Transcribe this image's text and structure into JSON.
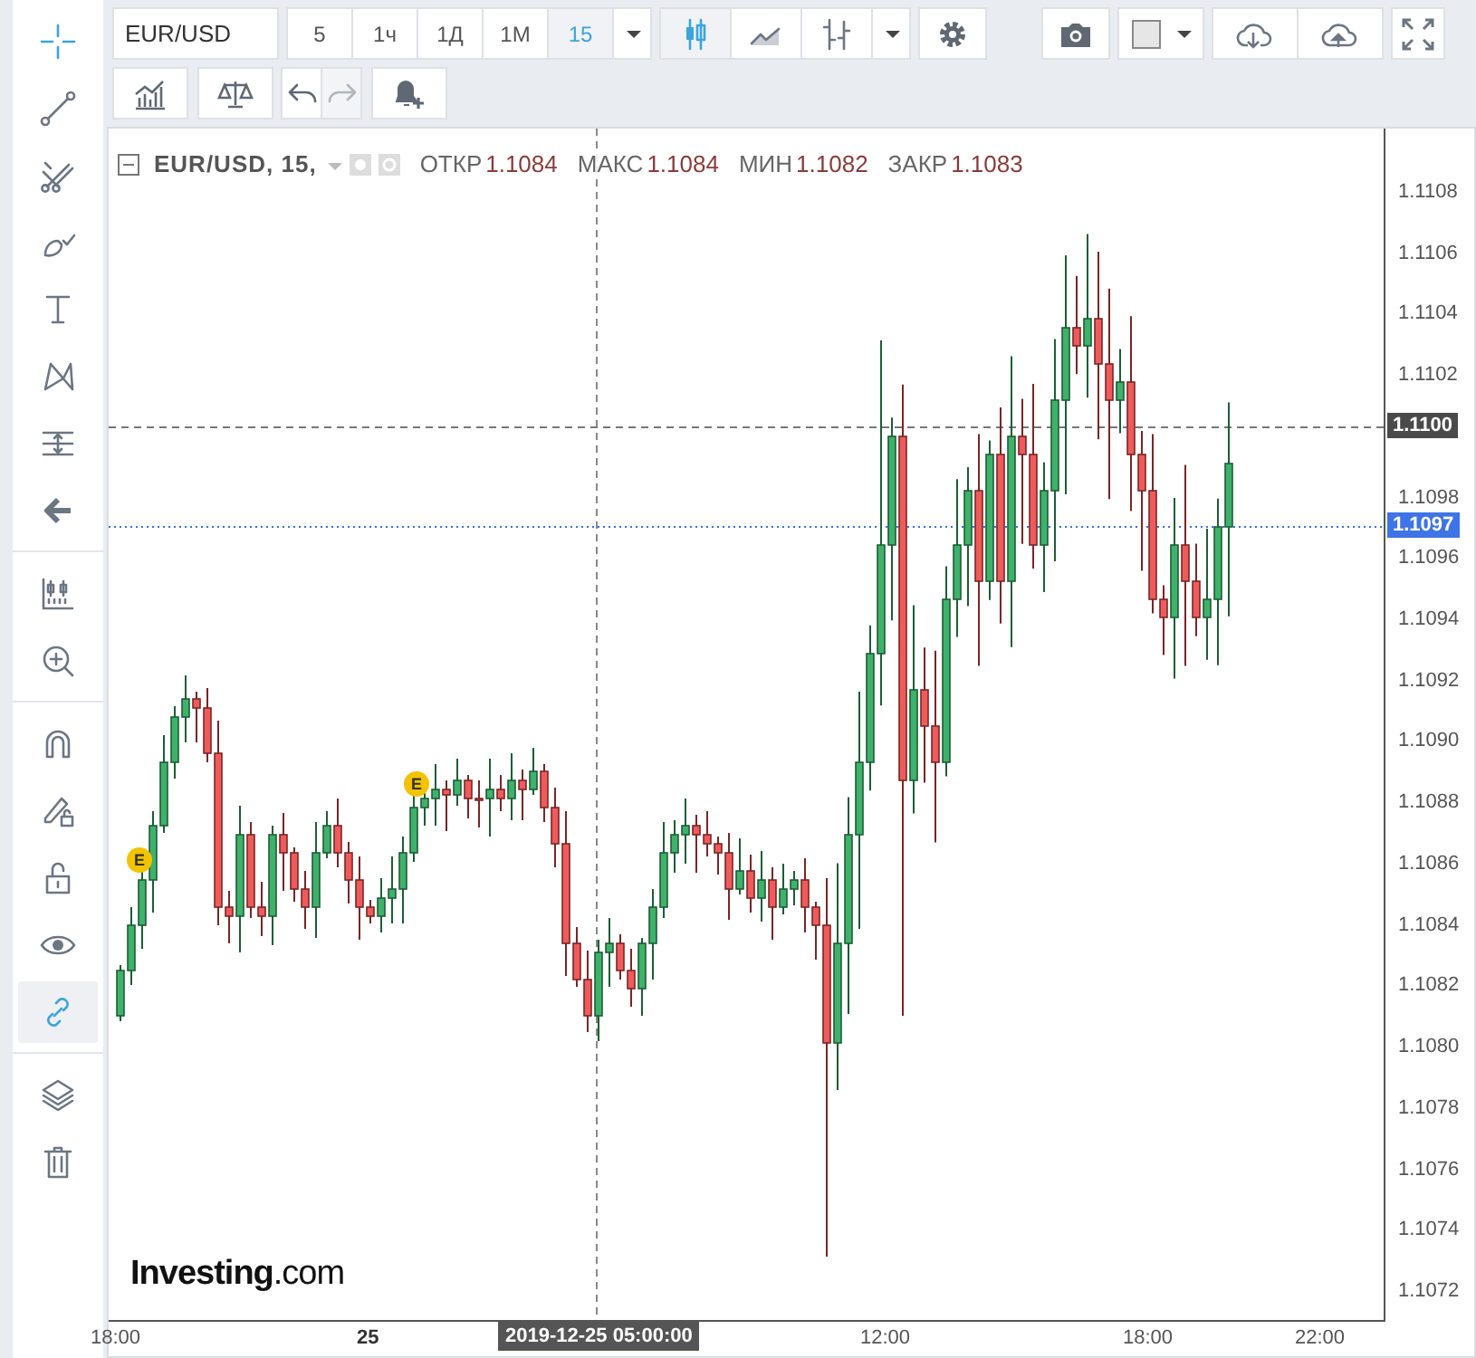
{
  "sidebar": {
    "groups": [
      [
        {
          "kind": "crosshair",
          "selected": true
        },
        {
          "kind": "trend-line",
          "selected": false
        },
        {
          "kind": "fork",
          "selected": false
        },
        {
          "kind": "brush",
          "selected": false
        },
        {
          "kind": "text",
          "selected": false
        },
        {
          "kind": "pattern",
          "selected": false
        },
        {
          "kind": "measure",
          "selected": false
        },
        {
          "kind": "arrow",
          "selected": false
        }
      ],
      [
        {
          "kind": "candle-ruler",
          "selected": false
        },
        {
          "kind": "zoom",
          "selected": false
        }
      ],
      [
        {
          "kind": "magnet",
          "selected": false
        },
        {
          "kind": "pencil-lock",
          "selected": false
        },
        {
          "kind": "lock",
          "selected": false
        },
        {
          "kind": "eye",
          "selected": false
        },
        {
          "kind": "link",
          "selected": true
        }
      ],
      [
        {
          "kind": "layers",
          "selected": false
        },
        {
          "kind": "trash",
          "selected": false
        }
      ]
    ]
  },
  "toolbar": {
    "symbol": "EUR/USD",
    "intervals": [
      {
        "label": "5",
        "selected": false
      },
      {
        "label": "1ч",
        "selected": false
      },
      {
        "label": "1Д",
        "selected": false
      },
      {
        "label": "1М",
        "selected": false
      },
      {
        "label": "15",
        "selected": true
      }
    ],
    "chart_types": [
      {
        "kind": "candles",
        "selected": true
      },
      {
        "kind": "area",
        "selected": false
      },
      {
        "kind": "bars",
        "selected": false
      }
    ],
    "history": [
      {
        "kind": "undo",
        "disabled": false
      },
      {
        "kind": "redo",
        "disabled": true
      }
    ]
  },
  "legend": {
    "symbol": "EUR/USD, 15,",
    "fields": [
      {
        "label": "ОТКР",
        "value": "1.1084"
      },
      {
        "label": "МАКС",
        "value": "1.1084"
      },
      {
        "label": "МИН",
        "value": "1.1082"
      },
      {
        "label": "ЗАКР",
        "value": "1.1083"
      }
    ]
  },
  "price_axis": {
    "labels": [
      "1.1108",
      "1.1106",
      "1.1104",
      "1.1102",
      "1.1098",
      "1.1096",
      "1.1094",
      "1.1092",
      "1.1090",
      "1.1088",
      "1.1086",
      "1.1084",
      "1.1082",
      "1.1080",
      "1.1078",
      "1.1076",
      "1.1074",
      "1.1072"
    ],
    "badges": [
      {
        "kind": "line",
        "value": "1.1100"
      },
      {
        "kind": "bid",
        "value": "1.1097"
      }
    ]
  },
  "time_axis": {
    "labels": [
      {
        "label": "18:00",
        "bold": false
      },
      {
        "label": "25",
        "bold": true
      },
      {
        "label": "12:00",
        "bold": false
      },
      {
        "label": "18:00",
        "bold": false
      },
      {
        "label": "22:00",
        "bold": false
      }
    ],
    "crosshair": "2019-12-25 05:00:00"
  },
  "events": [
    {
      "label": "E"
    },
    {
      "label": "E"
    }
  ],
  "logo": "**Investing**.com"
}
